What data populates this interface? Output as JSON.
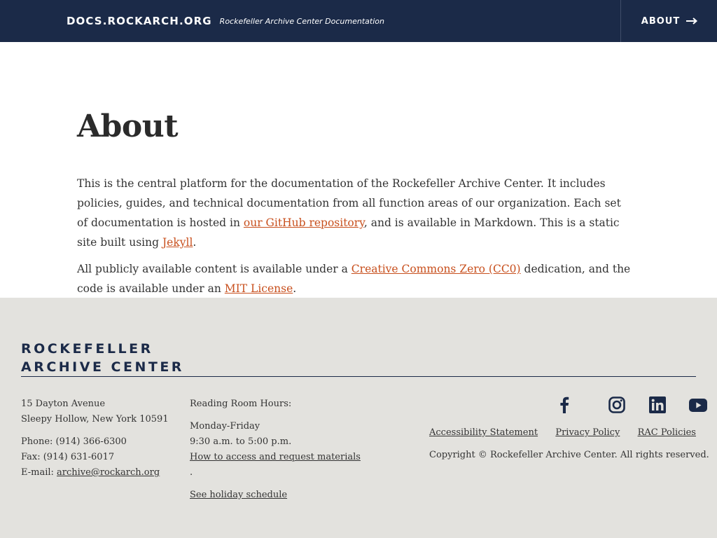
{
  "header": {
    "site_name": "DOCS.ROCKARCH.ORG",
    "tagline": "Rockefeller Archive Center Documentation",
    "nav_about": "ABOUT"
  },
  "main": {
    "title": "About",
    "intro": {
      "text_1": "This is the central platform for the documentation of the Rockefeller Archive Center. It includes policies, guides, and technical documentation from all function areas of our organization. Each set of documentation is hosted in ",
      "github_link": "our GitHub repository",
      "text_2": ", and is available in Markdown. This is a static site built using ",
      "jekyll_link": "Jekyll",
      "text_3": "."
    },
    "license": {
      "text_1": "All publicly available content is available under a ",
      "cc0_link": "Creative Commons Zero (CC0)",
      "text_2": " dedication, and the code is available under an ",
      "mit_link": "MIT License",
      "text_3": "."
    }
  },
  "footer": {
    "logo_line_1": "ROCKEFELLER",
    "logo_line_2": "ARCHIVE CENTER",
    "address": {
      "street": "15 Dayton Avenue",
      "city": "Sleepy Hollow, New York 10591",
      "phone": "Phone: (914) 366-6300",
      "fax": "Fax: (914) 631-6017",
      "email_label": "E-mail: ",
      "email": "archive@rockarch.org"
    },
    "hours": {
      "heading": "Reading Room Hours:",
      "days": "Monday-Friday",
      "times": "9:30 a.m. to 5:00 p.m.",
      "access_link": "How to access and request materials",
      "period": ".",
      "holiday_link": "See holiday schedule"
    },
    "social": [
      {
        "icon": "facebook-icon"
      },
      {
        "icon": "instagram-icon"
      },
      {
        "icon": "linkedin-icon"
      },
      {
        "icon": "youtube-icon"
      }
    ],
    "links": {
      "accessibility": "Accessibility Statement",
      "privacy": "Privacy Policy",
      "policies": "RAC Policies"
    },
    "copyright": "Copyright © Rockefeller Archive Center. All rights reserved."
  },
  "colors": {
    "header_bg": "#1b2a48",
    "link": "#c8501e",
    "footer_bg": "#e3e2de"
  }
}
